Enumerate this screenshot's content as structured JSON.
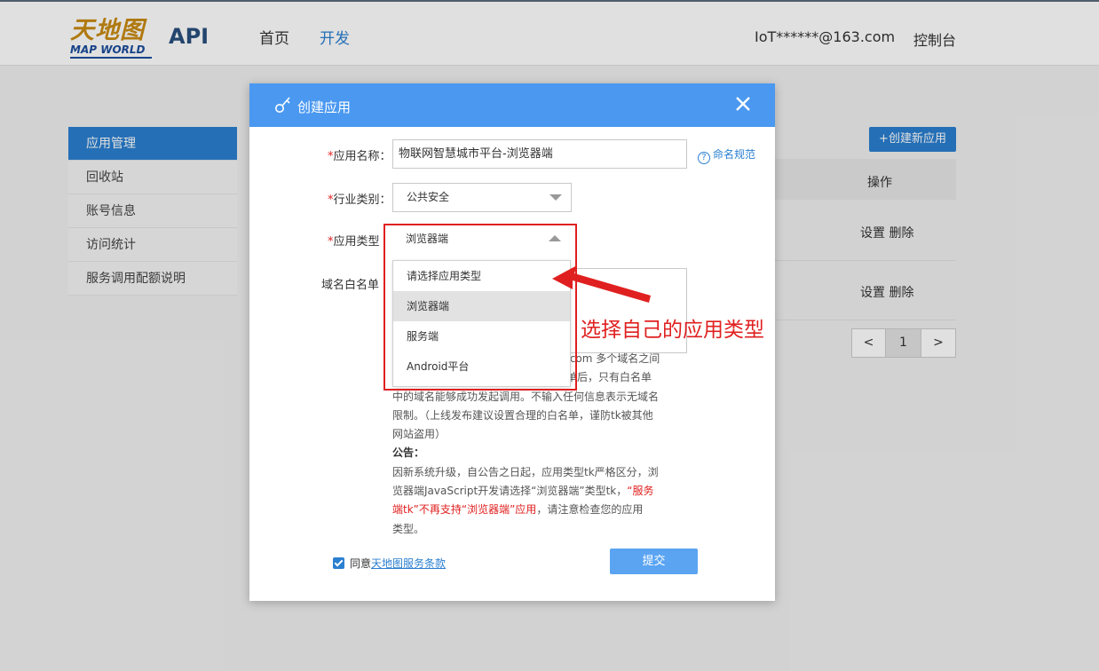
{
  "header": {
    "logo_cn": "天地图",
    "logo_en": "MAP WORLD",
    "brand_suffix": "API",
    "nav": {
      "home": "首页",
      "dev": "开发"
    },
    "user": "IoT******@163.com",
    "console": "控制台"
  },
  "sidebar": {
    "items": [
      {
        "label": "应用管理"
      },
      {
        "label": "回收站"
      },
      {
        "label": "账号信息"
      },
      {
        "label": "访问统计"
      },
      {
        "label": "服务调用配额说明"
      }
    ]
  },
  "main": {
    "create_button": "+创建新应用",
    "column_operation": "操作",
    "rows": [
      {
        "actions": "设置  删除"
      },
      {
        "actions": "设置  删除"
      }
    ],
    "pagination": {
      "prev": "<",
      "current": "1",
      "next": ">"
    }
  },
  "modal": {
    "title": "创建应用",
    "fields": {
      "name_label": "应用名称：",
      "name_value": "物联网智慧城市平台-浏览器端",
      "naming_rule_link": "命名规范",
      "industry_label": "行业类别：",
      "industry_value": "公共安全",
      "apptype_label": "应用类型",
      "apptype_value": "浏览器端",
      "whitelist_label": "域名白名单"
    },
    "dropdown_options": [
      "请选择应用类型",
      "浏览器端",
      "服务端",
      "Android平台"
    ],
    "notes": {
      "hint_line1_tail": ".com 多个域名之间",
      "hint_line2_tail": "单后，只有白名单",
      "hint_line3": "中的域名能够成功发起调用。不输入任何信息表示无域名",
      "hint_line4": "限制。（上线发布建议设置合理的白名单，谨防tk被其他",
      "hint_line5": "网站盗用）",
      "announcement_title": "公告：",
      "ann_line1": "因新系统升级，自公告之日起，应用类型tk严格区分，浏",
      "ann_line2_plain": "览器端JavaScript开发请选择“浏览器端”类型tk，",
      "ann_line2_red": "“服务",
      "ann_line3_red": "端tk”不再支持“浏览器端”应用",
      "ann_line3_plain": "，请注意检查您的应用",
      "ann_line4": "类型。"
    },
    "agree_prefix": "同意",
    "agree_link": "天地图服务条款",
    "submit": "提交"
  },
  "annotation": {
    "text": "选择自己的应用类型",
    "color": "#e02020"
  },
  "colors": {
    "primary": "#2b7fd0",
    "modal_header": "#4a98f0",
    "required": "#e02020"
  }
}
